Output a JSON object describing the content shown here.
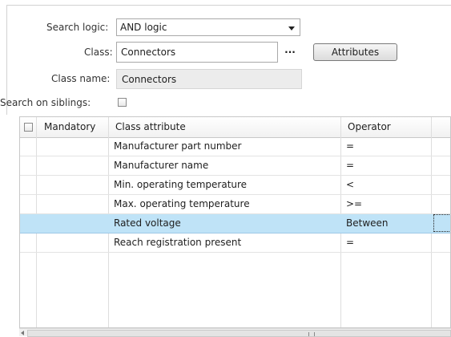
{
  "form": {
    "search_logic_label": "Search logic:",
    "search_logic_value": "AND logic",
    "class_label": "Class:",
    "class_value": "Connectors",
    "ellipsis_label": "...",
    "attributes_button": "Attributes",
    "class_name_label": "Class name:",
    "class_name_value": "Connectors",
    "search_siblings_label": "Search on siblings:",
    "search_siblings_checked": false
  },
  "table": {
    "columns": [
      "Mandatory",
      "Class attribute",
      "Operator"
    ],
    "rows": [
      {
        "mandatory": "",
        "attribute": "Manufacturer part number",
        "operator": "="
      },
      {
        "mandatory": "",
        "attribute": "Manufacturer name",
        "operator": "="
      },
      {
        "mandatory": "",
        "attribute": "Min. operating temperature",
        "operator": "<"
      },
      {
        "mandatory": "",
        "attribute": "Max. operating temperature",
        "operator": ">="
      },
      {
        "mandatory": "",
        "attribute": "Rated voltage",
        "operator": "Between",
        "selected": true
      },
      {
        "mandatory": "",
        "attribute": "Reach registration present",
        "operator": "="
      }
    ],
    "selected_row_color": "#bfe3f7"
  }
}
